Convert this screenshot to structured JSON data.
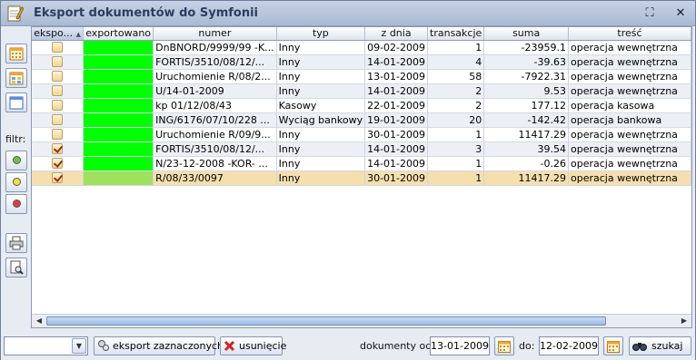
{
  "window": {
    "title": "Eksport dokumentów do Symfonii",
    "restore_glyph": "⛶",
    "close_glyph": "✕"
  },
  "sidebar": {
    "filter_label": "filtr:",
    "buttons": [
      "calendar-icon",
      "grid-icon",
      "window-icon"
    ],
    "filters": [
      {
        "name": "green-filter",
        "color": "#6ec43c"
      },
      {
        "name": "yellow-filter",
        "color": "#f4e23a"
      },
      {
        "name": "red-filter",
        "color": "#e23c3c"
      }
    ],
    "tools": [
      "printer-icon",
      "print-preview-icon"
    ]
  },
  "grid": {
    "columns": [
      "ekspo...",
      "exportowano",
      "numer",
      "typ",
      "z dnia",
      "transakcje",
      "suma",
      "treść"
    ],
    "rows": [
      {
        "checked": false,
        "exported": "green",
        "numer": "DnBNORD/9999/99 -K...",
        "typ": "Inny",
        "z_dnia": "09-02-2009",
        "transakcje": "1",
        "suma": "-23959.1",
        "tresc": "operacja wewnętrzna"
      },
      {
        "checked": false,
        "exported": "green",
        "numer": "FORTIS/3510/08/12/...",
        "typ": "Inny",
        "z_dnia": "14-01-2009",
        "transakcje": "4",
        "suma": "-39.63",
        "tresc": "operacja wewnętrzna"
      },
      {
        "checked": false,
        "exported": "green",
        "numer": "Uruchomienie R/08/2...",
        "typ": "Inny",
        "z_dnia": "13-01-2009",
        "transakcje": "58",
        "suma": "-7922.31",
        "tresc": "operacja wewnętrzna"
      },
      {
        "checked": false,
        "exported": "green",
        "numer": "U/14-01-2009",
        "typ": "Inny",
        "z_dnia": "14-01-2009",
        "transakcje": "2",
        "suma": "9.53",
        "tresc": "operacja wewnętrzna"
      },
      {
        "checked": false,
        "exported": "green",
        "numer": "kp 01/12/08/43",
        "typ": "Kasowy",
        "z_dnia": "22-01-2009",
        "transakcje": "2",
        "suma": "177.12",
        "tresc": "operacja kasowa"
      },
      {
        "checked": false,
        "exported": "green",
        "numer": "ING/6176/07/10/228 ...",
        "typ": "Wyciąg bankowy",
        "z_dnia": "19-01-2009",
        "transakcje": "20",
        "suma": "-142.42",
        "tresc": "operacja bankowa"
      },
      {
        "checked": false,
        "exported": "green",
        "numer": "Uruchomienie R/09/9...",
        "typ": "Inny",
        "z_dnia": "30-01-2009",
        "transakcje": "1",
        "suma": "11417.29",
        "tresc": "operacja wewnętrzna"
      },
      {
        "checked": true,
        "exported": "green",
        "numer": "FORTIS/3510/08/12/...",
        "typ": "Inny",
        "z_dnia": "14-01-2009",
        "transakcje": "3",
        "suma": "39.54",
        "tresc": "operacja wewnętrzna"
      },
      {
        "checked": true,
        "exported": "green",
        "numer": "N/23-12-2008 -KOR- ...",
        "typ": "Inny",
        "z_dnia": "14-01-2009",
        "transakcje": "1",
        "suma": "-0.26",
        "tresc": "operacja wewnętrzna"
      },
      {
        "checked": true,
        "exported": "greenlight",
        "numer": "R/08/33/0097",
        "typ": "Inny",
        "z_dnia": "30-01-2009",
        "transakcje": "1",
        "suma": "11417.29",
        "tresc": "operacja wewnętrzna",
        "selected": true
      }
    ]
  },
  "bottom": {
    "combo_value": "",
    "export_label": "eksport zaznaczonych",
    "delete_label": "usunięcie",
    "from_label": "dokumenty od:",
    "from_value": "13-01-2009",
    "to_label": "do:",
    "to_value": "12-02-2009",
    "search_label": "szukaj"
  }
}
